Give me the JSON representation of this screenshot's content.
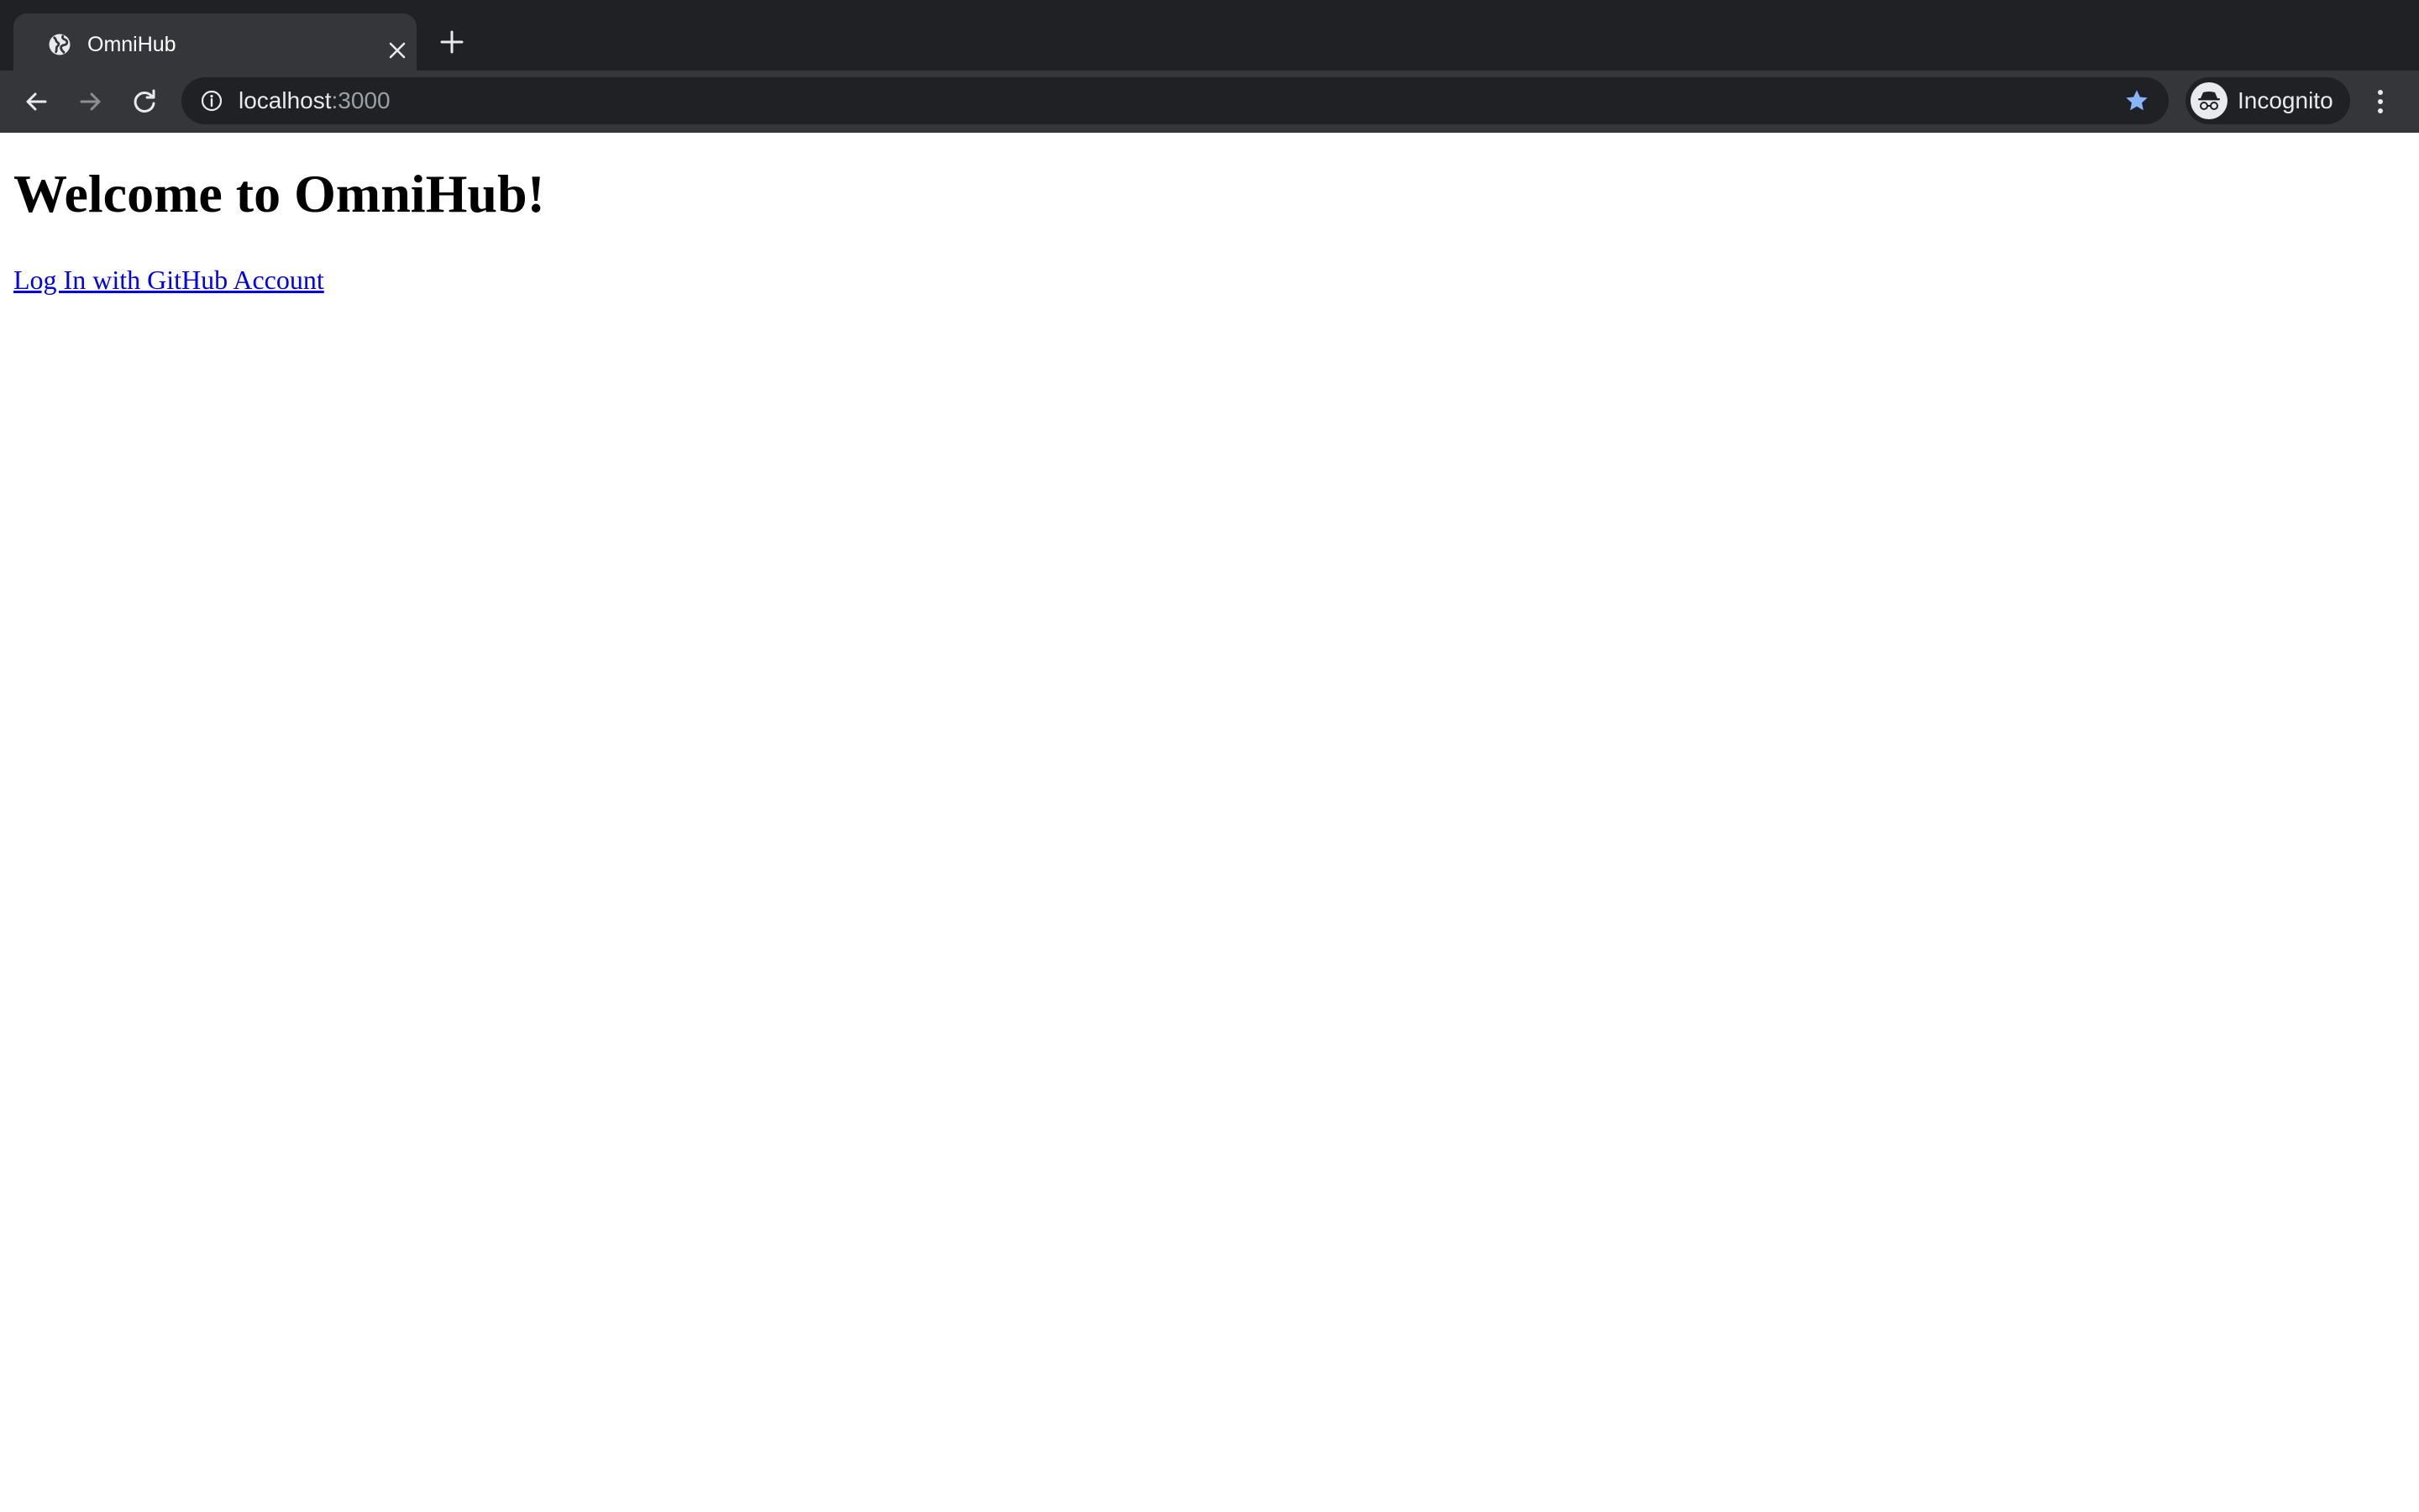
{
  "browser": {
    "tab": {
      "title": "OmniHub",
      "favicon": "globe-icon"
    },
    "address_bar": {
      "host": "localhost",
      "port": ":3000"
    },
    "profile": {
      "label": "Incognito",
      "icon": "incognito-icon"
    },
    "colors": {
      "tab_strip": "#202124",
      "toolbar": "#35363a",
      "omnibox": "#202124",
      "bookmark_star": "#8ab4f8"
    }
  },
  "page": {
    "heading": "Welcome to OmniHub!",
    "login_link": "Log In with GitHub Account",
    "link_color": "#0000ee"
  }
}
